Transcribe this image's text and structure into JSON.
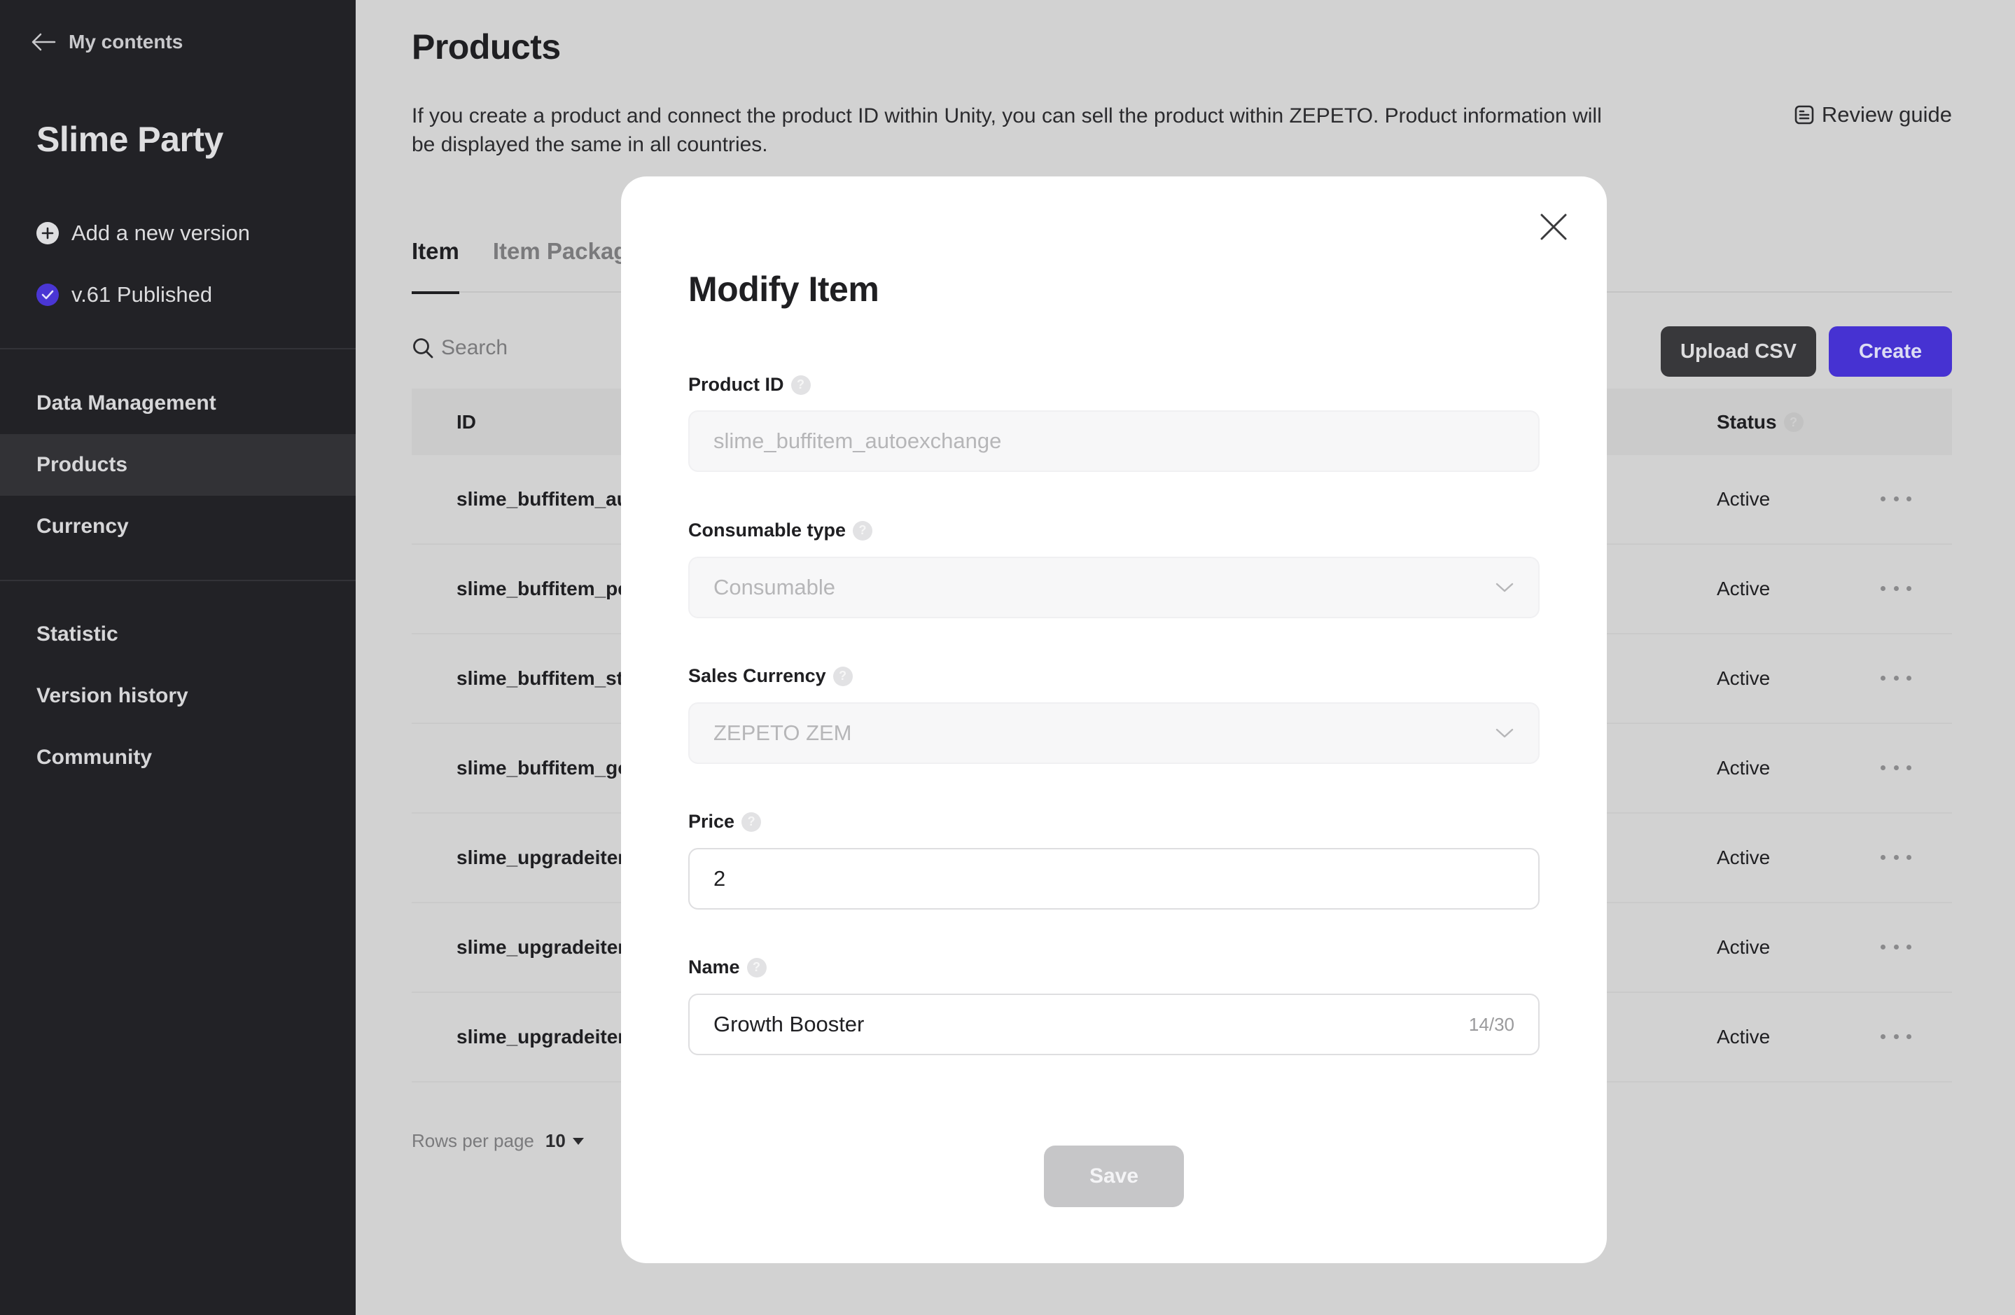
{
  "sidebar": {
    "back_label": "My contents",
    "app_title": "Slime Party",
    "add_version_label": "Add a new version",
    "published_version_label": "v.61 Published",
    "nav_group_1": [
      {
        "label": "Data Management",
        "active": false
      },
      {
        "label": "Products",
        "active": true
      },
      {
        "label": "Currency",
        "active": false
      }
    ],
    "nav_group_2": [
      {
        "label": "Statistic",
        "active": false
      },
      {
        "label": "Version history",
        "active": false
      },
      {
        "label": "Community",
        "active": false
      }
    ]
  },
  "main": {
    "title": "Products",
    "description": "If you create a product and connect the product ID within Unity, you can sell the product within ZEPETO. Product information will be displayed the same in all countries.",
    "review_guide_label": "Review guide",
    "tabs": [
      {
        "label": "Item",
        "active": true
      },
      {
        "label": "Item Package",
        "active": false
      }
    ],
    "search_placeholder": "Search",
    "upload_csv_label": "Upload CSV",
    "create_label": "Create",
    "table": {
      "columns": {
        "id": "ID",
        "status": "Status"
      },
      "rows": [
        {
          "id": "slime_buffitem_au",
          "status": "Active"
        },
        {
          "id": "slime_buffitem_pe",
          "status": "Active"
        },
        {
          "id": "slime_buffitem_sta",
          "status": "Active"
        },
        {
          "id": "slime_buffitem_go",
          "status": "Active"
        },
        {
          "id": "slime_upgradeitem",
          "status": "Active"
        },
        {
          "id": "slime_upgradeitem",
          "status": "Active"
        },
        {
          "id": "slime_upgradeitem",
          "status": "Active"
        }
      ]
    },
    "rows_per_page_label": "Rows per page",
    "rows_per_page_value": "10"
  },
  "modal": {
    "title": "Modify Item",
    "fields": {
      "product_id": {
        "label": "Product ID",
        "value": "slime_buffitem_autoexchange"
      },
      "consumable_type": {
        "label": "Consumable type",
        "value": "Consumable"
      },
      "sales_currency": {
        "label": "Sales Currency",
        "value": "ZEPETO ZEM"
      },
      "price": {
        "label": "Price",
        "value": "2"
      },
      "name": {
        "label": "Name",
        "value": "Growth Booster",
        "counter": "14/30"
      }
    },
    "help_glyph": "?",
    "save_label": "Save"
  },
  "colors": {
    "accent": "#4632d2",
    "published_badge": "#4a36d4",
    "sidebar_bg": "#222226",
    "overlay_bg": "#d2d2d2"
  }
}
